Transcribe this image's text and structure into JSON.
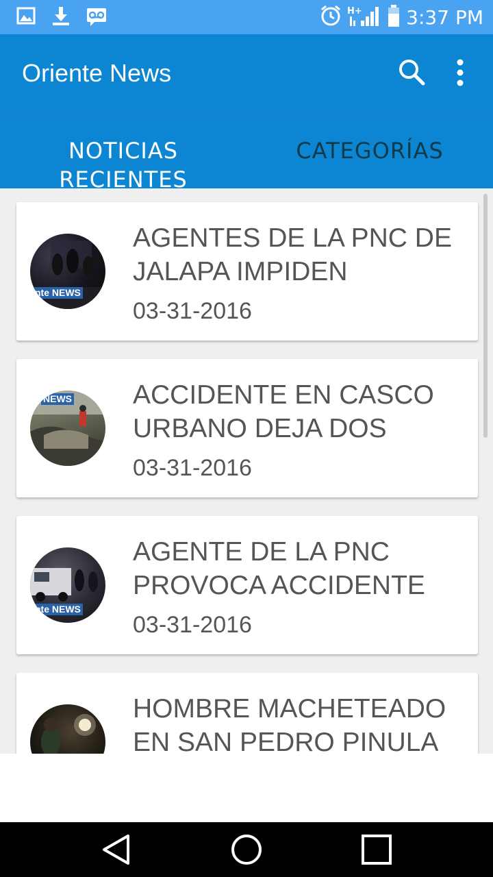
{
  "status_bar": {
    "time": "3:37 PM",
    "left_icons": [
      "image-icon",
      "download-icon",
      "voicemail-icon"
    ],
    "right_icons": [
      "alarm-icon",
      "signal-h-plus-icon",
      "battery-icon"
    ]
  },
  "app_bar": {
    "title": "Oriente News",
    "icons": [
      "search-icon",
      "more-vert-icon"
    ]
  },
  "tabs": [
    {
      "label": "NOTICIAS\nRECIENTES",
      "selected": true
    },
    {
      "label": "CATEGORÍAS",
      "selected": false
    }
  ],
  "news": [
    {
      "title": "AGENTES DE LA PNC DE JALAPA IMPIDEN",
      "date": "03-31-2016",
      "thumb_tag": "nte NEWS"
    },
    {
      "title": "ACCIDENTE EN CASCO URBANO DEJA DOS",
      "date": "03-31-2016",
      "thumb_tag": "NEWS"
    },
    {
      "title": "AGENTE DE LA PNC PROVOCA ACCIDENTE",
      "date": "03-31-2016",
      "thumb_tag": "nte NEWS"
    },
    {
      "title": "HOMBRE MACHETEADO EN SAN PEDRO PINULA",
      "date": "",
      "thumb_tag": ""
    }
  ],
  "nav_bar": {
    "icons": [
      "back-icon",
      "home-icon",
      "recents-icon"
    ]
  },
  "colors": {
    "status_bar": "#4aa3f0",
    "primary": "#0c86d2",
    "tab_inactive": "#103a4a",
    "card_text": "#555555",
    "list_background": "#efefef"
  }
}
